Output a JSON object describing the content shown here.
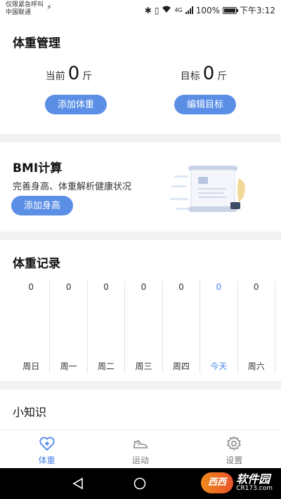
{
  "status_bar": {
    "carrier_line1": "仅限紧急呼叫",
    "carrier_line2": "中国联通",
    "network": "4G",
    "battery": "100%",
    "time": "下午3:12"
  },
  "weight": {
    "title": "体重管理",
    "current_label": "当前",
    "current_value": "0",
    "current_unit": "斤",
    "target_label": "目标",
    "target_value": "0",
    "target_unit": "斤",
    "add_button": "添加体重",
    "edit_button": "编辑目标"
  },
  "bmi": {
    "title": "BMI计算",
    "desc": "完善身高、体重解析健康状况",
    "add_button": "添加身高"
  },
  "record": {
    "title": "体重记录",
    "days": [
      {
        "label": "周日",
        "value": "0"
      },
      {
        "label": "周一",
        "value": "0"
      },
      {
        "label": "周二",
        "value": "0"
      },
      {
        "label": "周三",
        "value": "0"
      },
      {
        "label": "周四",
        "value": "0"
      },
      {
        "label": "今天",
        "value": "0"
      },
      {
        "label": "周六",
        "value": "0"
      }
    ]
  },
  "tips": {
    "title": "小知识"
  },
  "tabs": [
    {
      "label": "体重",
      "icon": "heart-plus-icon"
    },
    {
      "label": "运动",
      "icon": "shoe-icon"
    },
    {
      "label": "设置",
      "icon": "gear-icon"
    }
  ],
  "watermark": {
    "brand": "软件园",
    "site": "CR173.com",
    "logo": "西西"
  },
  "colors": {
    "accent": "#5b8fe6",
    "today": "#4a86e8"
  }
}
